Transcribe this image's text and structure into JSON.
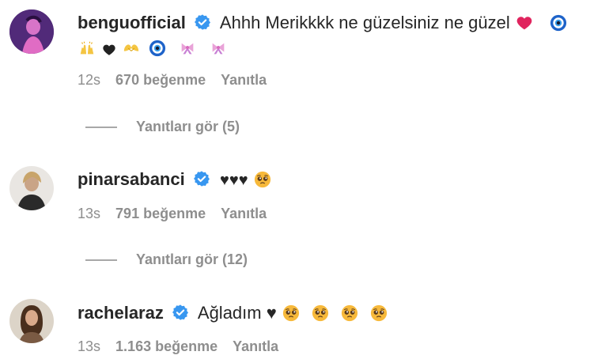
{
  "comments": [
    {
      "username": "benguofficial",
      "verified": true,
      "text": "Ahhh Merikkkk ne güzelsiniz ne güzel",
      "time": "12s",
      "likes": "670 beğenme",
      "reply": "Yanıtla",
      "view_replies": "Yanıtları gör (5)",
      "emojis_line1": [
        "red-heart",
        "nazar-amulet"
      ],
      "emojis_line2": [
        "raising-hands",
        "black-heart",
        "heart-hands",
        "nazar-amulet",
        "pink-bow",
        "pink-bow"
      ]
    },
    {
      "username": "pinarsabanci",
      "verified": true,
      "text": "♥♥♥",
      "time": "13s",
      "likes": "791 beğenme",
      "reply": "Yanıtla",
      "view_replies": "Yanıtları gör (12)",
      "emojis": [
        "pleading-face"
      ]
    },
    {
      "username": "rachelaraz",
      "verified": true,
      "text": "Ağladım ♥",
      "time": "13s",
      "likes": "1.163 beğenme",
      "reply": "Yanıtla",
      "emojis": [
        "pleading-face",
        "pleading-face",
        "pleading-face",
        "pleading-face"
      ]
    }
  ],
  "colors": {
    "text": "#262626",
    "secondary": "#8e8e8e",
    "verified": "#3897f0",
    "red_heart": "#e0245e"
  }
}
